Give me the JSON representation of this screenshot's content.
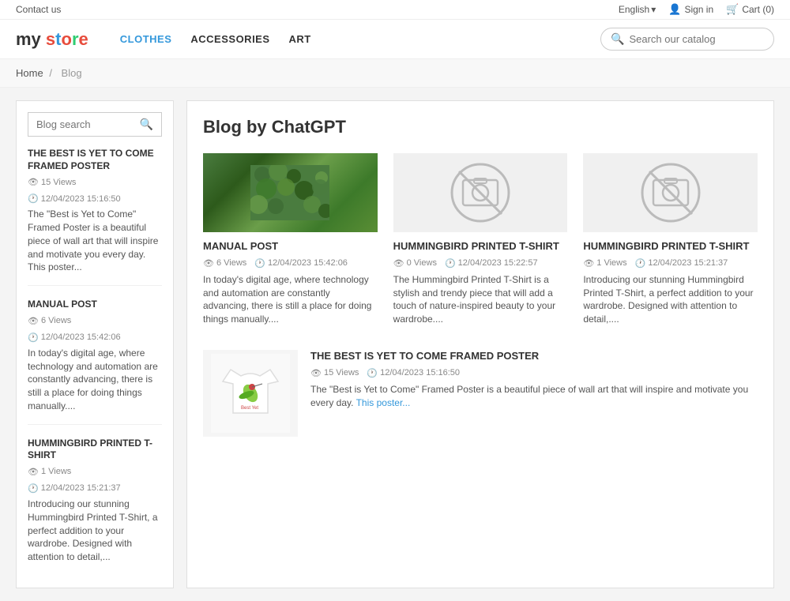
{
  "topbar": {
    "contact_label": "Contact us",
    "language_label": "English",
    "language_icon": "▾",
    "signin_label": "Sign in",
    "cart_label": "Cart (0)"
  },
  "header": {
    "logo": {
      "my": "my ",
      "store": "store"
    },
    "nav": [
      {
        "label": "CLOTHES",
        "active": true
      },
      {
        "label": "ACCESSORIES",
        "active": false
      },
      {
        "label": "ART",
        "active": false
      }
    ],
    "search_placeholder": "Search our catalog"
  },
  "breadcrumb": {
    "home": "Home",
    "separator": "/",
    "current": "Blog"
  },
  "sidebar": {
    "search_placeholder": "Blog search",
    "posts": [
      {
        "title": "THE BEST IS YET TO COME FRAMED POSTER",
        "views": "15 Views",
        "date": "12/04/2023 15:16:50",
        "excerpt": "The \"Best is Yet to Come\" Framed Poster is a beautiful piece of wall art that will inspire and motivate you every day. This poster..."
      },
      {
        "title": "MANUAL POST",
        "views": "6 Views",
        "date": "12/04/2023 15:42:06",
        "excerpt": "In today's digital age, where technology and automation are constantly advancing, there is still a place for doing things manually...."
      },
      {
        "title": "HUMMINGBIRD PRINTED T-SHIRT",
        "views": "1 Views",
        "date": "12/04/2023 15:21:37",
        "excerpt": "Introducing our stunning Hummingbird Printed T-Shirt, a perfect addition to your wardrobe. Designed with attention to detail,..."
      }
    ]
  },
  "blog": {
    "title": "Blog by ChatGPT",
    "cards": [
      {
        "id": "manual-post",
        "image_type": "moss",
        "title": "MANUAL POST",
        "views": "6 Views",
        "date": "12/04/2023 15:42:06",
        "excerpt": "In today's digital age, where technology and automation are constantly advancing, there is still a place for doing things manually...."
      },
      {
        "id": "hummingbird-1",
        "image_type": "no-image",
        "title": "HUMMINGBIRD PRINTED T-SHIRT",
        "views": "0 Views",
        "date": "12/04/2023 15:22:57",
        "excerpt": "The Hummingbird Printed T-Shirt is a stylish and trendy piece that will add a touch of nature-inspired beauty to your wardrobe...."
      },
      {
        "id": "hummingbird-2",
        "image_type": "no-image",
        "title": "HUMMINGBIRD PRINTED T-SHIRT",
        "views": "1 Views",
        "date": "12/04/2023 15:21:37",
        "excerpt": "Introducing our stunning Hummingbird Printed T-Shirt, a perfect addition to your wardrobe. Designed with attention to detail,...."
      }
    ],
    "bottom_post": {
      "image_type": "tshirt",
      "title": "THE BEST IS YET TO COME FRAMED POSTER",
      "views": "15 Views",
      "date": "12/04/2023 15:16:50",
      "excerpt": "The \"Best is Yet to Come\" Framed Poster is a beautiful piece of wall art that will inspire and motivate you every day.",
      "excerpt_link": "This poster..."
    }
  },
  "colors": {
    "accent": "#3498db",
    "title": "#333",
    "meta": "#888",
    "border": "#e0e0e0"
  }
}
